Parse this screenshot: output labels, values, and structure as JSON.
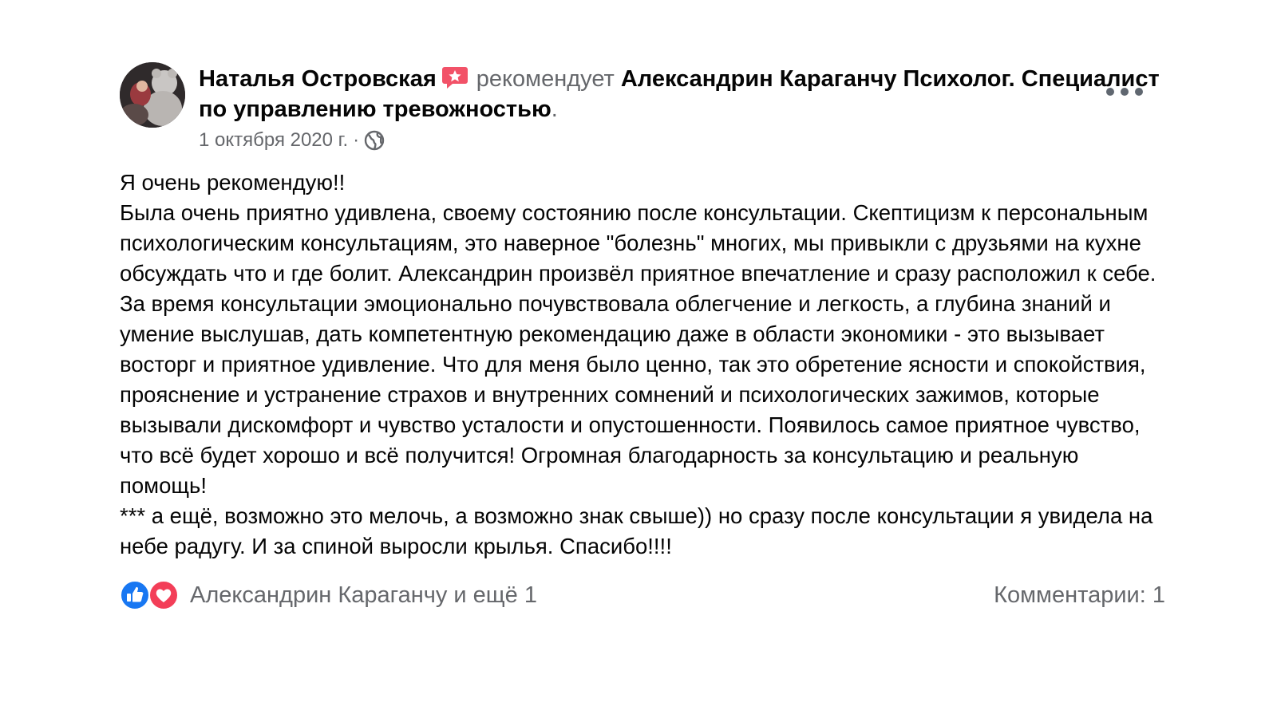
{
  "post": {
    "author": "Наталья Островская",
    "verb": "рекомендует",
    "page_name": "Александрин Караганчу Психолог. Специалист по управлению тревожностью",
    "trailing_dot": ".",
    "date": "1 октября 2020 г.",
    "separator": "·",
    "audience_icon": "globe-icon",
    "badge_icon": "star-badge-icon",
    "more_icon": "more-options-icon",
    "text": "Я очень рекомендую!!\nБыла очень приятно удивлена, своему состоянию после консультации. Скептицизм к персональным психологическим консультациям, это наверное \"болезнь\" многих, мы привыкли с друзьями на кухне обсуждать что и где болит. Александрин произвёл приятное впечатление и сразу расположил к себе. За время консультации эмоционально почувствовала облегчение и легкость, а глубина знаний и умение выслушав, дать компетентную рекомендацию даже в области экономики - это вызывает восторг и приятное удивление. Что для меня было ценно, так это обретение ясности и спокойствия, прояснение и устранение страхов и внутренних сомнений и психологических зажимов, которые вызывали дискомфорт и чувство усталости и опустошенности. Появилось самое приятное чувство, что всё будет хорошо и всё получится! Огромная благодарность за консультацию и реальную помощь!\n*** а ещё, возможно это мелочь, а возможно знак свыше)) но сразу после консультации я увидела на небе радугу. И за спиной выросли крылья. Спасибо!!!!"
  },
  "footer": {
    "reaction_icons": [
      "like-icon",
      "love-icon"
    ],
    "reactions_text": "Александрин Караганчу и ещё 1",
    "comments_text": "Комментарии: 1"
  },
  "colors": {
    "text_primary": "#050505",
    "text_secondary": "#65676b",
    "like_blue": "#1877f2",
    "love_red": "#f33e58",
    "badge_pink": "#f25268"
  }
}
